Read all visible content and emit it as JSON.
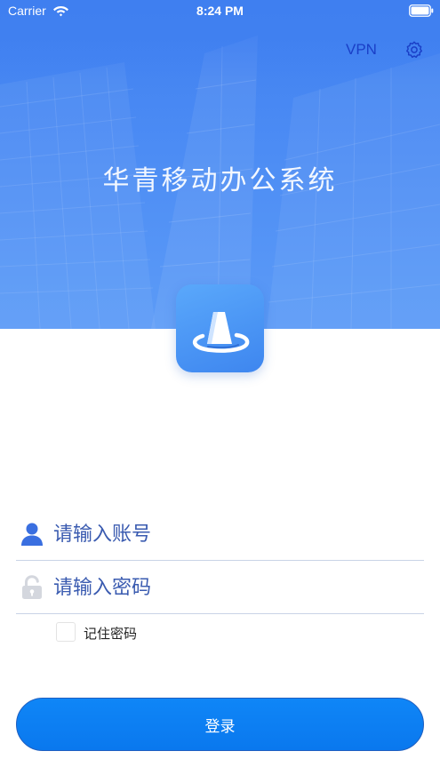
{
  "status_bar": {
    "carrier": "Carrier",
    "time": "8:24 PM",
    "icons": [
      "wifi-icon",
      "battery-icon"
    ]
  },
  "header": {
    "vpn_label": "VPN",
    "settings_icon": "gear-icon",
    "title": "华青移动办公系统",
    "logo_icon": "app-logo-icon"
  },
  "form": {
    "account": {
      "placeholder": "请输入账号",
      "value": "",
      "icon": "user-icon"
    },
    "password": {
      "placeholder": "请输入密码",
      "value": "",
      "icon": "lock-icon"
    },
    "remember": {
      "label": "记住密码",
      "checked": false
    },
    "login_label": "登录"
  },
  "colors": {
    "header_blue": "#4a88f2",
    "vpn_text": "#1a3fc7",
    "login_button": "#0a7ef2",
    "input_text": "#3a5bb0",
    "divider": "#c9d3e6"
  }
}
